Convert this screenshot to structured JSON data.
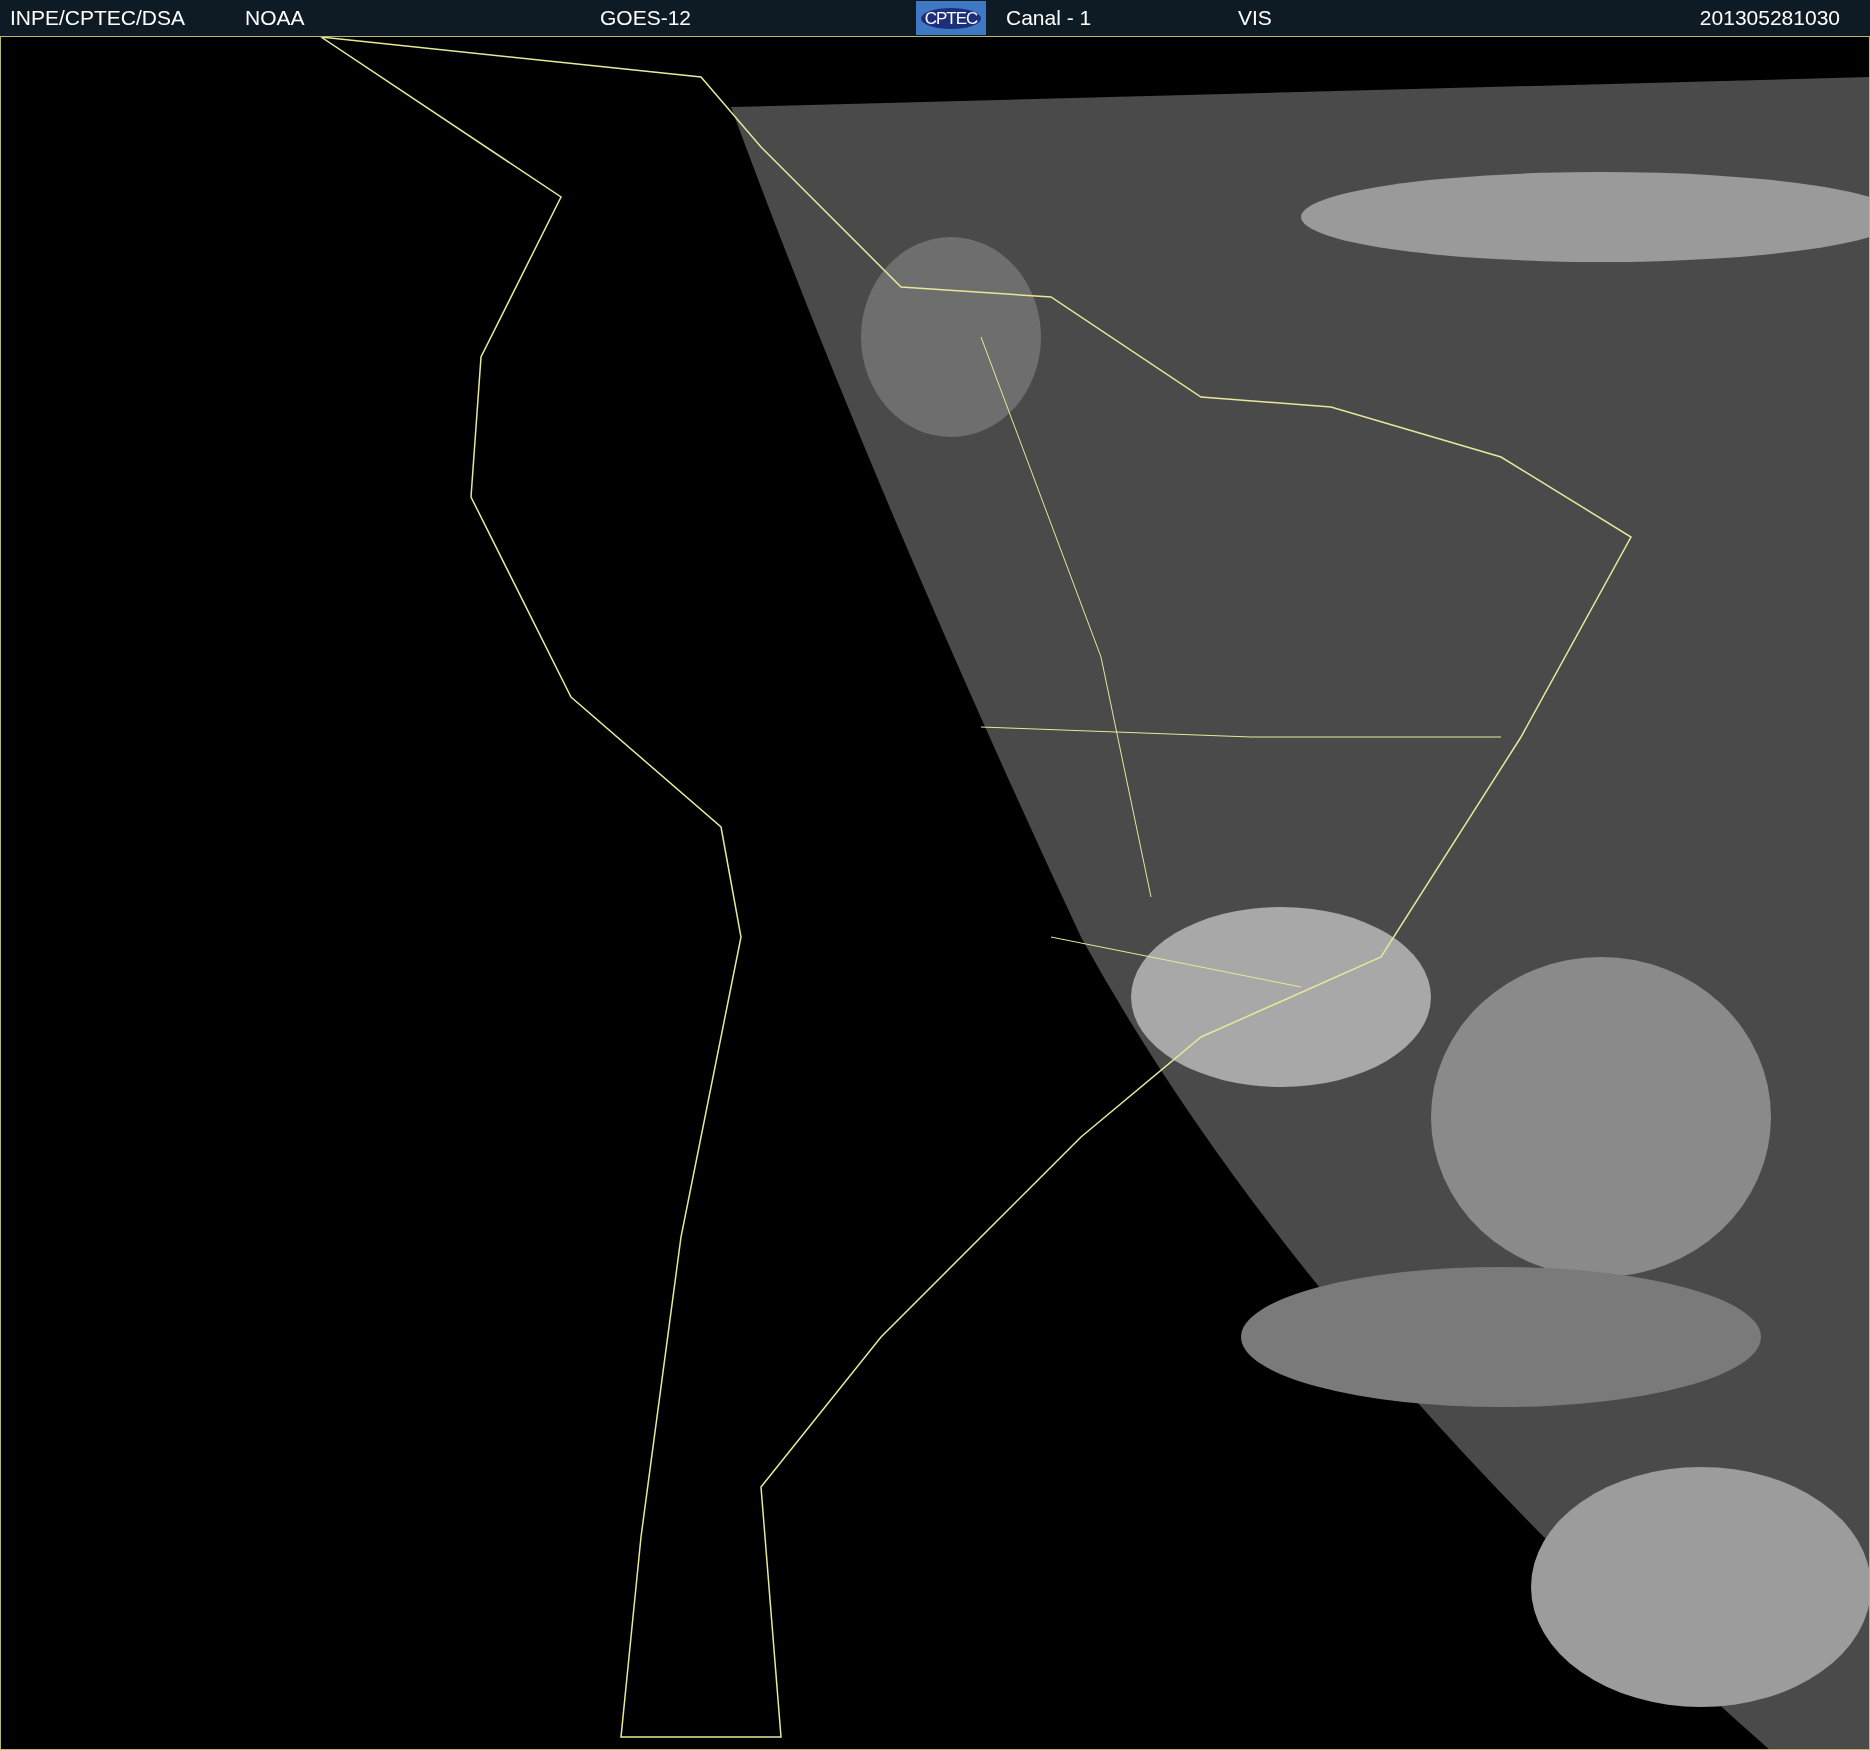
{
  "header": {
    "source": "INPE/CPTEC/DSA",
    "agency": "NOAA",
    "satellite": "GOES-12",
    "logo": "CPTEC",
    "channel": "Canal - 1",
    "band": "VIS",
    "timestamp": "201305281030"
  }
}
